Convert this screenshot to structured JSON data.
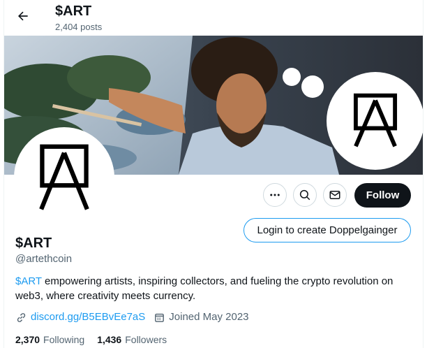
{
  "header": {
    "title": "$ART",
    "posts": "2,404 posts"
  },
  "profile": {
    "name": "$ART",
    "handle": "@artethcoin",
    "bio_tag": "$ART",
    "bio_text": " empowering artists, inspiring collectors, and fueling the crypto revolution on web3, where creativity meets currency.",
    "link": "discord.gg/B5EBvEe7aS",
    "joined": "Joined May 2023"
  },
  "actions": {
    "follow": "Follow",
    "doppelgainger": "Login to create Doppelgainger"
  },
  "stats": {
    "following_count": "2,370",
    "following_label": "Following",
    "followers_count": "1,436",
    "followers_label": "Followers"
  },
  "icons": [
    "back-arrow-icon",
    "more-icon",
    "search-icon",
    "envelope-icon",
    "link-icon",
    "calendar-icon",
    "easel-logo-icon"
  ],
  "colors": {
    "accent": "#1d9bf0",
    "text": "#0f1419",
    "secondary": "#536471",
    "border": "#cfd9de",
    "follow_bg": "#0f1419"
  }
}
